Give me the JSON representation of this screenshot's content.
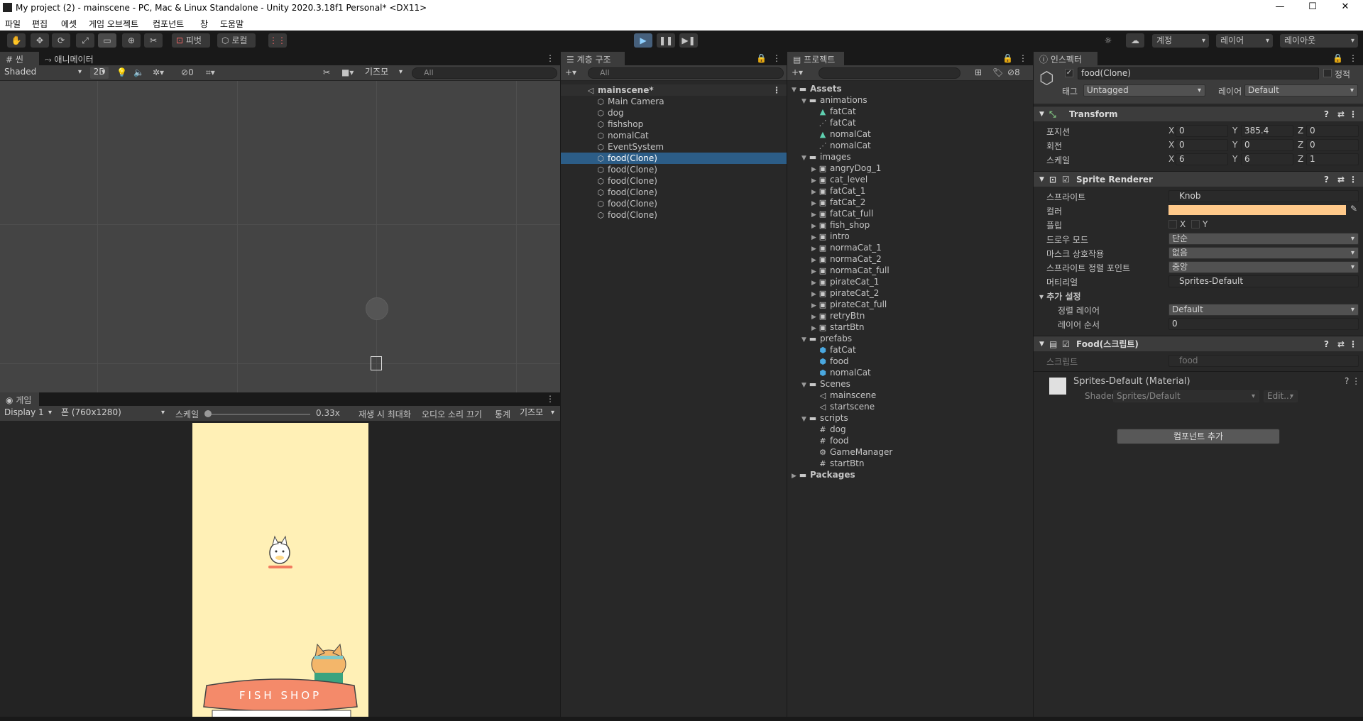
{
  "window": {
    "title": "My project (2) - mainscene - PC, Mac & Linux Standalone - Unity 2020.3.18f1 Personal* <DX11>",
    "minimize": "—",
    "maximize": "☐",
    "close": "✕"
  },
  "menu": [
    "파일",
    "편집",
    "에셋",
    "게임 오브젝트",
    "컴포넌트",
    "창",
    "도움말"
  ],
  "toolbar": {
    "pivot": "피벗",
    "local": "로컬",
    "account": "계정",
    "layers": "레이어",
    "layout": "레이아웃"
  },
  "scene": {
    "tab_scene": "씬",
    "tab_animator": "애니메이터",
    "shading": "Shaded",
    "mode2d": "2D",
    "hidden_count": "0",
    "gizmos": "기즈모",
    "search_placeholder": "All"
  },
  "game": {
    "tab": "게임",
    "display": "Display 1",
    "resolution": "폰 (760x1280)",
    "scale_label": "스케일",
    "scale_value": "0.33x",
    "maximize": "재생 시 최대화",
    "mute": "오디오 소리 끄기",
    "stats": "통계",
    "gizmos": "기즈모",
    "shop_sign": "FISH SHOP"
  },
  "hierarchy": {
    "tab": "계층 구조",
    "search_placeholder": "All",
    "scene": "mainscene*",
    "items": [
      "Main Camera",
      "dog",
      "fishshop",
      "nomalCat",
      "EventSystem",
      "food(Clone)",
      "food(Clone)",
      "food(Clone)",
      "food(Clone)",
      "food(Clone)",
      "food(Clone)"
    ],
    "selected_index": 5
  },
  "project": {
    "tab": "프로젝트",
    "hidden_count": "8",
    "tree": [
      {
        "name": "Assets",
        "depth": 0,
        "type": "folder",
        "bold": true
      },
      {
        "name": "animations",
        "depth": 1,
        "type": "folder"
      },
      {
        "name": "fatCat",
        "depth": 2,
        "type": "anim"
      },
      {
        "name": "fatCat",
        "depth": 2,
        "type": "controller"
      },
      {
        "name": "nomalCat",
        "depth": 2,
        "type": "anim"
      },
      {
        "name": "nomalCat",
        "depth": 2,
        "type": "controller"
      },
      {
        "name": "images",
        "depth": 1,
        "type": "folder"
      },
      {
        "name": "angryDog_1",
        "depth": 2,
        "type": "sprite"
      },
      {
        "name": "cat_level",
        "depth": 2,
        "type": "sprite"
      },
      {
        "name": "fatCat_1",
        "depth": 2,
        "type": "sprite"
      },
      {
        "name": "fatCat_2",
        "depth": 2,
        "type": "sprite"
      },
      {
        "name": "fatCat_full",
        "depth": 2,
        "type": "sprite"
      },
      {
        "name": "fish_shop",
        "depth": 2,
        "type": "sprite"
      },
      {
        "name": "intro",
        "depth": 2,
        "type": "sprite"
      },
      {
        "name": "normaCat_1",
        "depth": 2,
        "type": "sprite"
      },
      {
        "name": "normaCat_2",
        "depth": 2,
        "type": "sprite"
      },
      {
        "name": "normaCat_full",
        "depth": 2,
        "type": "sprite"
      },
      {
        "name": "pirateCat_1",
        "depth": 2,
        "type": "sprite"
      },
      {
        "name": "pirateCat_2",
        "depth": 2,
        "type": "sprite"
      },
      {
        "name": "pirateCat_full",
        "depth": 2,
        "type": "sprite"
      },
      {
        "name": "retryBtn",
        "depth": 2,
        "type": "sprite"
      },
      {
        "name": "startBtn",
        "depth": 2,
        "type": "sprite"
      },
      {
        "name": "prefabs",
        "depth": 1,
        "type": "folder"
      },
      {
        "name": "fatCat",
        "depth": 2,
        "type": "prefab"
      },
      {
        "name": "food",
        "depth": 2,
        "type": "prefab"
      },
      {
        "name": "nomalCat",
        "depth": 2,
        "type": "prefab"
      },
      {
        "name": "Scenes",
        "depth": 1,
        "type": "folder"
      },
      {
        "name": "mainscene",
        "depth": 2,
        "type": "scene"
      },
      {
        "name": "startscene",
        "depth": 2,
        "type": "scene"
      },
      {
        "name": "scripts",
        "depth": 1,
        "type": "folder"
      },
      {
        "name": "dog",
        "depth": 2,
        "type": "script"
      },
      {
        "name": "food",
        "depth": 2,
        "type": "script"
      },
      {
        "name": "GameManager",
        "depth": 2,
        "type": "gear"
      },
      {
        "name": "startBtn",
        "depth": 2,
        "type": "script"
      },
      {
        "name": "Packages",
        "depth": 0,
        "type": "folder",
        "bold": true
      }
    ]
  },
  "inspector": {
    "tab": "인스펙터",
    "object_name": "food(Clone)",
    "static": "정적",
    "tag_label": "태그",
    "tag": "Untagged",
    "layer_label": "레이어",
    "layer": "Default",
    "transform": {
      "title": "Transform",
      "position_label": "포지션",
      "rotation_label": "회전",
      "scale_label": "스케일",
      "position": {
        "x": "0",
        "y": "385.4",
        "z": "0"
      },
      "rotation": {
        "x": "0",
        "y": "0",
        "z": "0"
      },
      "scale": {
        "x": "6",
        "y": "6",
        "z": "1"
      }
    },
    "sprite_renderer": {
      "title": "Sprite Renderer",
      "sprite_label": "스프라이트",
      "sprite": "Knob",
      "color_label": "컬러",
      "color": "#ffc98a",
      "flip_label": "플립",
      "flip_x": "X",
      "flip_y": "Y",
      "draw_mode_label": "드로우 모드",
      "draw_mode": "단순",
      "mask_label": "마스크 상호작용",
      "mask": "없음",
      "sort_point_label": "스프라이트 정렬 포인트",
      "sort_point": "중앙",
      "material_label": "머티리얼",
      "material": "Sprites-Default",
      "additional": "추가 설정",
      "sorting_layer_label": "정렬 레이어",
      "sorting_layer": "Default",
      "order_label": "레이어 순서",
      "order": "0"
    },
    "food_script": {
      "title": "Food(스크립트)",
      "script_label": "스크립트",
      "script": "food"
    },
    "material": {
      "title": "Sprites-Default (Material)",
      "shader_label": "Shader",
      "shader": "Sprites/Default",
      "edit": "Edit..."
    },
    "add_component": "컴포넌트 추가"
  }
}
